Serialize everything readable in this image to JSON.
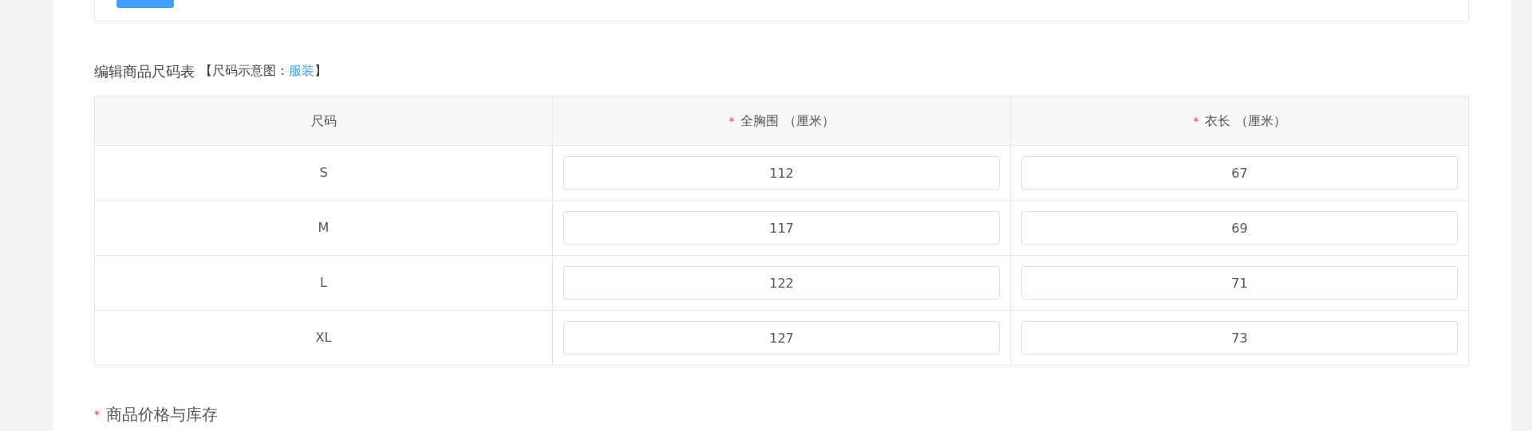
{
  "required_mark": "*",
  "section_title": {
    "text": "编辑商品尺码表",
    "hint_prefix": "【尺码示意图：",
    "hint_link": "服装",
    "hint_suffix": "】"
  },
  "size_table": {
    "columns": [
      {
        "label": "尺码",
        "required": false
      },
      {
        "label": "全胸围 （厘米）",
        "required": true
      },
      {
        "label": "衣长 （厘米）",
        "required": true
      }
    ],
    "rows": [
      {
        "size": "S",
        "values": [
          "112",
          "67"
        ]
      },
      {
        "size": "M",
        "values": [
          "117",
          "69"
        ]
      },
      {
        "size": "L",
        "values": [
          "122",
          "71"
        ]
      },
      {
        "size": "XL",
        "values": [
          "127",
          "73"
        ]
      }
    ]
  },
  "next_section": {
    "label": "商品价格与库存",
    "required": true
  }
}
